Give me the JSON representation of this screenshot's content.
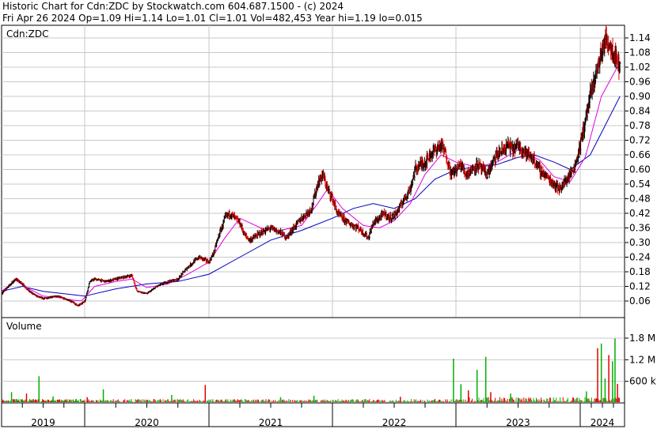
{
  "header": {
    "line1": "Historic Chart for Cdn:ZDC by Stockwatch.com 604.687.1500 - (c) 2024",
    "line2": "Fri Apr 26 2024   Op=1.09  Hi=1.14  Lo=1.01  Cl=1.01  Vol=482,453  Year hi=1.19  lo=0.015"
  },
  "chart_data": [
    {
      "type": "ohlc",
      "title": "Cdn:ZDC",
      "y_ticks": [
        "1.14",
        "1.08",
        "1.02",
        "0.96",
        "0.90",
        "0.84",
        "0.78",
        "0.72",
        "0.66",
        "0.60",
        "0.54",
        "0.48",
        "0.42",
        "0.36",
        "0.30",
        "0.24",
        "0.18",
        "0.12",
        "0.06"
      ],
      "ylim": [
        0.015,
        1.19
      ],
      "grid": true,
      "colors": {
        "up": "#000000",
        "down": "#e00000",
        "ma_short": "#e000e0",
        "ma_long": "#0000c0"
      },
      "close_path": [
        [
          2019.0,
          0.09
        ],
        [
          2019.08,
          0.12
        ],
        [
          2019.17,
          0.15
        ],
        [
          2019.25,
          0.13
        ],
        [
          2019.33,
          0.1
        ],
        [
          2019.42,
          0.08
        ],
        [
          2019.5,
          0.07
        ],
        [
          2019.58,
          0.075
        ],
        [
          2019.67,
          0.08
        ],
        [
          2019.75,
          0.07
        ],
        [
          2019.83,
          0.06
        ],
        [
          2019.92,
          0.04
        ],
        [
          2020.0,
          0.06
        ],
        [
          2020.04,
          0.14
        ],
        [
          2020.08,
          0.15
        ],
        [
          2020.17,
          0.14
        ],
        [
          2020.25,
          0.15
        ],
        [
          2020.33,
          0.16
        ],
        [
          2020.38,
          0.165
        ],
        [
          2020.42,
          0.1
        ],
        [
          2020.5,
          0.09
        ],
        [
          2020.58,
          0.12
        ],
        [
          2020.67,
          0.14
        ],
        [
          2020.75,
          0.15
        ],
        [
          2020.83,
          0.2
        ],
        [
          2020.92,
          0.24
        ],
        [
          2021.0,
          0.22
        ],
        [
          2021.04,
          0.26
        ],
        [
          2021.08,
          0.33
        ],
        [
          2021.13,
          0.4
        ],
        [
          2021.17,
          0.42
        ],
        [
          2021.21,
          0.4
        ],
        [
          2021.25,
          0.38
        ],
        [
          2021.29,
          0.33
        ],
        [
          2021.33,
          0.31
        ],
        [
          2021.42,
          0.34
        ],
        [
          2021.5,
          0.36
        ],
        [
          2021.58,
          0.34
        ],
        [
          2021.63,
          0.32
        ],
        [
          2021.67,
          0.35
        ],
        [
          2021.75,
          0.4
        ],
        [
          2021.83,
          0.44
        ],
        [
          2021.88,
          0.54
        ],
        [
          2021.92,
          0.58
        ],
        [
          2021.96,
          0.52
        ],
        [
          2022.0,
          0.48
        ],
        [
          2022.04,
          0.42
        ],
        [
          2022.08,
          0.4
        ],
        [
          2022.13,
          0.38
        ],
        [
          2022.17,
          0.37
        ],
        [
          2022.21,
          0.36
        ],
        [
          2022.25,
          0.34
        ],
        [
          2022.29,
          0.32
        ],
        [
          2022.33,
          0.38
        ],
        [
          2022.38,
          0.4
        ],
        [
          2022.42,
          0.42
        ],
        [
          2022.46,
          0.4
        ],
        [
          2022.5,
          0.41
        ],
        [
          2022.54,
          0.44
        ],
        [
          2022.58,
          0.48
        ],
        [
          2022.63,
          0.52
        ],
        [
          2022.67,
          0.6
        ],
        [
          2022.71,
          0.62
        ],
        [
          2022.75,
          0.63
        ],
        [
          2022.79,
          0.66
        ],
        [
          2022.83,
          0.68
        ],
        [
          2022.88,
          0.7
        ],
        [
          2022.92,
          0.66
        ],
        [
          2022.96,
          0.58
        ],
        [
          2023.0,
          0.6
        ],
        [
          2023.04,
          0.62
        ],
        [
          2023.08,
          0.58
        ],
        [
          2023.13,
          0.6
        ],
        [
          2023.17,
          0.62
        ],
        [
          2023.21,
          0.6
        ],
        [
          2023.25,
          0.58
        ],
        [
          2023.29,
          0.62
        ],
        [
          2023.33,
          0.66
        ],
        [
          2023.38,
          0.68
        ],
        [
          2023.42,
          0.7
        ],
        [
          2023.46,
          0.68
        ],
        [
          2023.5,
          0.7
        ],
        [
          2023.54,
          0.68
        ],
        [
          2023.58,
          0.66
        ],
        [
          2023.63,
          0.64
        ],
        [
          2023.67,
          0.6
        ],
        [
          2023.71,
          0.58
        ],
        [
          2023.75,
          0.56
        ],
        [
          2023.79,
          0.54
        ],
        [
          2023.83,
          0.52
        ],
        [
          2023.88,
          0.55
        ],
        [
          2023.92,
          0.58
        ],
        [
          2023.96,
          0.62
        ],
        [
          2024.0,
          0.7
        ],
        [
          2024.04,
          0.8
        ],
        [
          2024.08,
          0.9
        ],
        [
          2024.13,
          1.0
        ],
        [
          2024.17,
          1.08
        ],
        [
          2024.21,
          1.14
        ],
        [
          2024.25,
          1.1
        ],
        [
          2024.29,
          1.06
        ],
        [
          2024.32,
          1.01
        ]
      ],
      "ma_short": [
        [
          2019.0,
          0.1
        ],
        [
          2019.17,
          0.145
        ],
        [
          2019.33,
          0.11
        ],
        [
          2019.5,
          0.08
        ],
        [
          2019.67,
          0.075
        ],
        [
          2019.83,
          0.065
        ],
        [
          2019.96,
          0.06
        ],
        [
          2020.08,
          0.12
        ],
        [
          2020.25,
          0.14
        ],
        [
          2020.38,
          0.15
        ],
        [
          2020.5,
          0.115
        ],
        [
          2020.67,
          0.13
        ],
        [
          2020.83,
          0.17
        ],
        [
          2021.0,
          0.22
        ],
        [
          2021.13,
          0.32
        ],
        [
          2021.25,
          0.4
        ],
        [
          2021.42,
          0.36
        ],
        [
          2021.58,
          0.35
        ],
        [
          2021.75,
          0.37
        ],
        [
          2021.88,
          0.46
        ],
        [
          2021.96,
          0.52
        ],
        [
          2022.08,
          0.44
        ],
        [
          2022.25,
          0.37
        ],
        [
          2022.38,
          0.36
        ],
        [
          2022.5,
          0.39
        ],
        [
          2022.63,
          0.46
        ],
        [
          2022.75,
          0.58
        ],
        [
          2022.88,
          0.66
        ],
        [
          2023.0,
          0.63
        ],
        [
          2023.17,
          0.61
        ],
        [
          2023.33,
          0.63
        ],
        [
          2023.5,
          0.68
        ],
        [
          2023.67,
          0.64
        ],
        [
          2023.79,
          0.57
        ],
        [
          2023.92,
          0.55
        ],
        [
          2024.04,
          0.65
        ],
        [
          2024.17,
          0.9
        ],
        [
          2024.32,
          1.04
        ]
      ],
      "ma_long": [
        [
          2019.0,
          0.1
        ],
        [
          2019.25,
          0.12
        ],
        [
          2019.5,
          0.1
        ],
        [
          2019.75,
          0.09
        ],
        [
          2020.0,
          0.08
        ],
        [
          2020.25,
          0.11
        ],
        [
          2020.5,
          0.13
        ],
        [
          2020.75,
          0.14
        ],
        [
          2021.0,
          0.17
        ],
        [
          2021.25,
          0.24
        ],
        [
          2021.5,
          0.31
        ],
        [
          2021.75,
          0.35
        ],
        [
          2022.0,
          0.4
        ],
        [
          2022.17,
          0.44
        ],
        [
          2022.33,
          0.46
        ],
        [
          2022.5,
          0.44
        ],
        [
          2022.67,
          0.48
        ],
        [
          2022.83,
          0.56
        ],
        [
          2023.0,
          0.6
        ],
        [
          2023.17,
          0.61
        ],
        [
          2023.33,
          0.62
        ],
        [
          2023.5,
          0.65
        ],
        [
          2023.63,
          0.66
        ],
        [
          2023.79,
          0.63
        ],
        [
          2023.92,
          0.6
        ],
        [
          2024.08,
          0.66
        ],
        [
          2024.2,
          0.78
        ],
        [
          2024.32,
          0.9
        ]
      ]
    },
    {
      "type": "bar",
      "title": "Volume",
      "y_ticks": [
        "1.8 M",
        "1.2 M",
        "600 k"
      ],
      "ylim": [
        0,
        2000000
      ],
      "grid": true,
      "spikes": [
        [
          2019.12,
          300000
        ],
        [
          2019.3,
          260000
        ],
        [
          2019.45,
          740000
        ],
        [
          2019.62,
          180000
        ],
        [
          2020.02,
          160000
        ],
        [
          2020.15,
          380000
        ],
        [
          2020.7,
          220000
        ],
        [
          2020.97,
          500000
        ],
        [
          2021.58,
          160000
        ],
        [
          2021.85,
          200000
        ],
        [
          2022.55,
          170000
        ],
        [
          2022.98,
          1230000
        ],
        [
          2023.04,
          520000
        ],
        [
          2023.1,
          350000
        ],
        [
          2023.17,
          920000
        ],
        [
          2023.24,
          1280000
        ],
        [
          2023.28,
          300000
        ],
        [
          2023.44,
          260000
        ],
        [
          2024.05,
          320000
        ],
        [
          2024.14,
          1520000
        ],
        [
          2024.17,
          1650000
        ],
        [
          2024.2,
          680000
        ],
        [
          2024.23,
          1330000
        ],
        [
          2024.26,
          1160000
        ],
        [
          2024.28,
          1790000
        ],
        [
          2024.3,
          530000
        ]
      ]
    }
  ],
  "x_axis": {
    "labels": [
      "2019",
      "2020",
      "2021",
      "2022",
      "2023",
      "2024"
    ]
  }
}
